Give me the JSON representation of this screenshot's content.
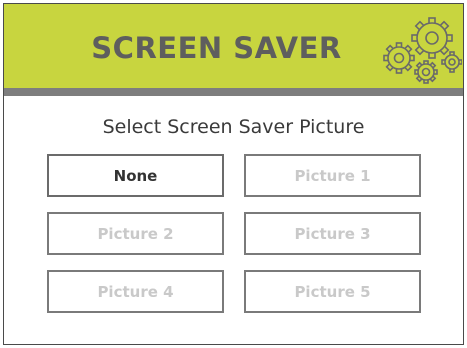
{
  "header": {
    "title": "SCREEN SAVER",
    "icon": "gears-icon",
    "background_color": "#c8d53f"
  },
  "prompt": "Select Screen Saver Picture",
  "options": [
    {
      "label": "None",
      "selected": true
    },
    {
      "label": "Picture 1",
      "selected": false
    },
    {
      "label": "Picture 2",
      "selected": false
    },
    {
      "label": "Picture 3",
      "selected": false
    },
    {
      "label": "Picture 4",
      "selected": false
    },
    {
      "label": "Picture 5",
      "selected": false
    }
  ]
}
